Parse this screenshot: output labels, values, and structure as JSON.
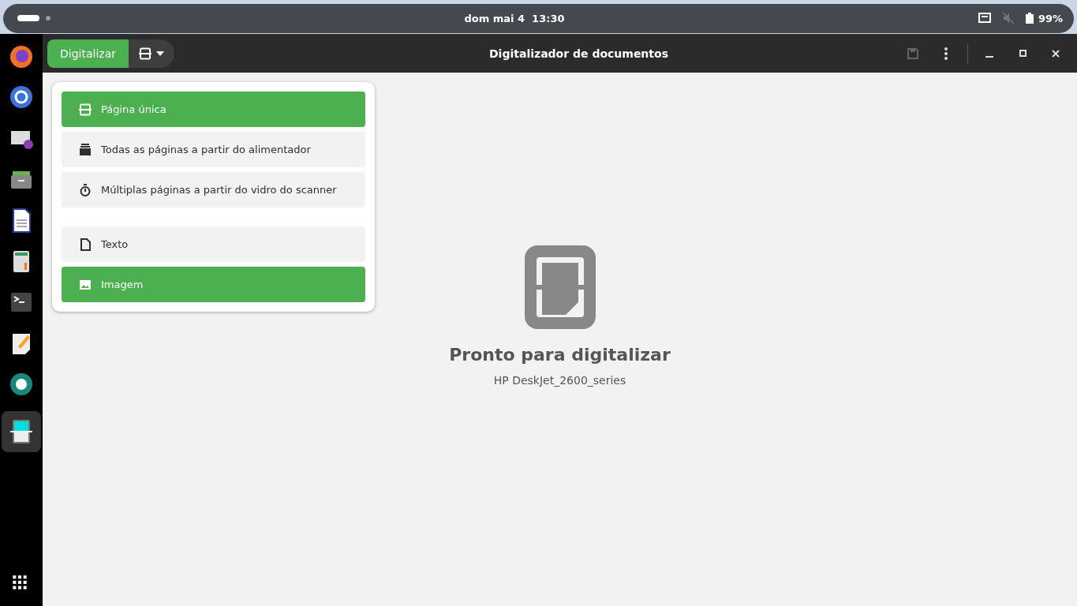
{
  "top_bar": {
    "clock": "dom mai 4  13:30",
    "battery": "99%"
  },
  "window": {
    "title": "Digitalizador de documentos",
    "scan_button": "Digitalizar"
  },
  "menu": {
    "scan_types": [
      {
        "kind": "single",
        "label": "Página única",
        "selected": true
      },
      {
        "kind": "feeder",
        "label": "Todas as páginas a partir do alimentador",
        "selected": false
      },
      {
        "kind": "timer",
        "label": "Múltiplas páginas a partir do vidro do scanner",
        "selected": false
      }
    ],
    "document_types": [
      {
        "kind": "text",
        "label": "Texto",
        "selected": false
      },
      {
        "kind": "image",
        "label": "Imagem",
        "selected": true
      }
    ]
  },
  "status": {
    "heading": "Pronto para digitalizar",
    "device": "HP DeskJet_2600_series"
  }
}
